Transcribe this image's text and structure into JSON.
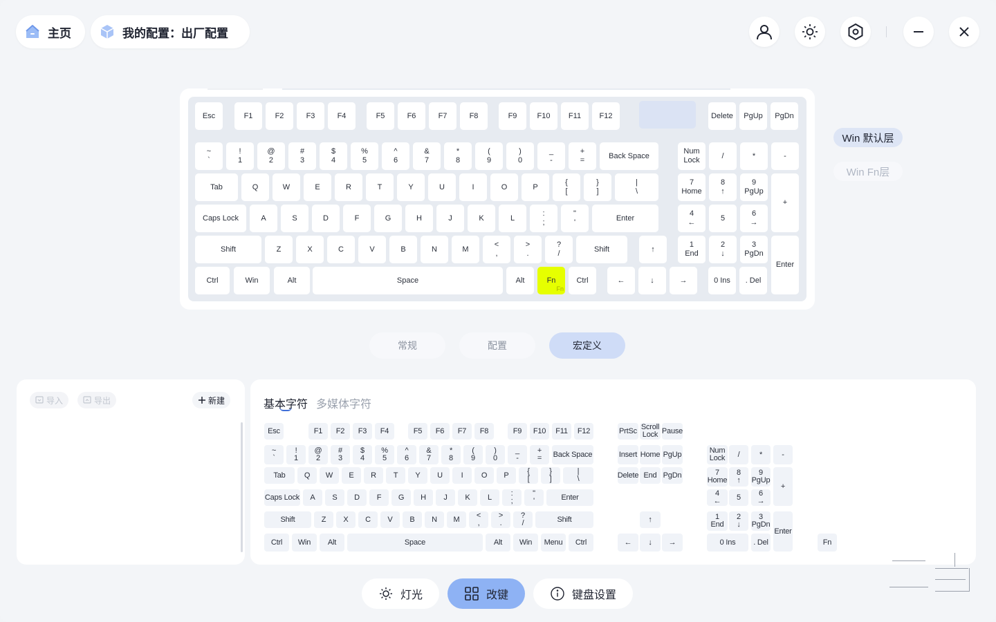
{
  "topbar": {
    "home_label": "主页",
    "config_label": "我的配置：出厂配置"
  },
  "layers": {
    "default": "Win 默认层",
    "fn": "Win Fn层"
  },
  "modes": [
    "常规",
    "配置",
    "宏定义"
  ],
  "left_panel": {
    "import_label": "导入",
    "export_label": "导出",
    "new_label": "新建"
  },
  "char_tabs": {
    "basic": "基本字符",
    "media": "多媒体字符"
  },
  "bottom_nav": {
    "light": "灯光",
    "remap": "改键",
    "settings": "键盘设置"
  },
  "colors": {
    "accent": "#8eb2f4",
    "selected_key": "#e6ff00",
    "active_mode": "#cfdcf7"
  },
  "keyboard": {
    "keys": [
      {
        "l": "Esc"
      },
      {
        "l": "F1"
      },
      {
        "l": "F2"
      },
      {
        "l": "F3"
      },
      {
        "l": "F4"
      },
      {
        "l": "F5"
      },
      {
        "l": "F6"
      },
      {
        "l": "F7"
      },
      {
        "l": "F8"
      },
      {
        "l": "F9"
      },
      {
        "l": "F10"
      },
      {
        "l": "F11"
      },
      {
        "l": "F12"
      },
      {
        "l": ""
      },
      {
        "l": "Delete"
      },
      {
        "l": "PgUp"
      },
      {
        "l": "PgDn"
      },
      {
        "l": "~\n`"
      },
      {
        "l": "!\n1"
      },
      {
        "l": "@\n2"
      },
      {
        "l": "#\n3"
      },
      {
        "l": "$\n4"
      },
      {
        "l": "%\n5"
      },
      {
        "l": "^\n6"
      },
      {
        "l": "&\n7"
      },
      {
        "l": "*\n8"
      },
      {
        "l": "(\n9"
      },
      {
        "l": ")\n0"
      },
      {
        "l": "_\n-"
      },
      {
        "l": "+\n="
      },
      {
        "l": "Back Space"
      },
      {
        "l": "Num\nLock"
      },
      {
        "l": "/"
      },
      {
        "l": "*"
      },
      {
        "l": "-"
      },
      {
        "l": "Tab"
      },
      {
        "l": "Q"
      },
      {
        "l": "W"
      },
      {
        "l": "E"
      },
      {
        "l": "R"
      },
      {
        "l": "T"
      },
      {
        "l": "Y"
      },
      {
        "l": "U"
      },
      {
        "l": "I"
      },
      {
        "l": "O"
      },
      {
        "l": "P"
      },
      {
        "l": "{\n["
      },
      {
        "l": "}\n]"
      },
      {
        "l": "|\n\\"
      },
      {
        "l": "7\nHome"
      },
      {
        "l": "8\n↑"
      },
      {
        "l": "9\nPgUp"
      },
      {
        "l": "+"
      },
      {
        "l": "Caps Lock"
      },
      {
        "l": "A"
      },
      {
        "l": "S"
      },
      {
        "l": "D"
      },
      {
        "l": "F"
      },
      {
        "l": "G"
      },
      {
        "l": "H"
      },
      {
        "l": "J"
      },
      {
        "l": "K"
      },
      {
        "l": "L"
      },
      {
        "l": ":\n;"
      },
      {
        "l": "\"\n'"
      },
      {
        "l": "Enter"
      },
      {
        "l": "4\n←"
      },
      {
        "l": "5"
      },
      {
        "l": "6\n→"
      },
      {
        "l": "Shift"
      },
      {
        "l": "Z"
      },
      {
        "l": "X"
      },
      {
        "l": "C"
      },
      {
        "l": "V"
      },
      {
        "l": "B"
      },
      {
        "l": "N"
      },
      {
        "l": "M"
      },
      {
        "l": "<\n,"
      },
      {
        "l": ">\n."
      },
      {
        "l": "?\n/"
      },
      {
        "l": "Shift"
      },
      {
        "l": "↑"
      },
      {
        "l": "1\nEnd"
      },
      {
        "l": "2\n↓"
      },
      {
        "l": "3\nPgDn"
      },
      {
        "l": "Enter"
      },
      {
        "l": "Ctrl"
      },
      {
        "l": "Win"
      },
      {
        "l": "Alt"
      },
      {
        "l": "Space"
      },
      {
        "l": "Alt"
      },
      {
        "l": "Fn",
        "selected": true,
        "sub": "Fn"
      },
      {
        "l": "Ctrl"
      },
      {
        "l": "←"
      },
      {
        "l": "↓"
      },
      {
        "l": "→"
      },
      {
        "l": "0 Ins"
      },
      {
        "l": ". Del"
      }
    ]
  },
  "charset": {
    "keys": [
      "Esc",
      "F1",
      "F2",
      "F3",
      "F4",
      "F5",
      "F6",
      "F7",
      "F8",
      "F9",
      "F10",
      "F11",
      "F12",
      "PrtSc",
      "Scroll\nLock",
      "Pause",
      "~\n`",
      "!\n1",
      "@\n2",
      "#\n3",
      "$\n4",
      "%\n5",
      "^\n6",
      "&\n7",
      "*\n8",
      "(\n9",
      ")\n0",
      "_\n-",
      "+\n=",
      "Back Space",
      "Insert",
      "Home",
      "PgUp",
      "Num\nLock",
      "/",
      "*",
      "-",
      "Tab",
      "Q",
      "W",
      "E",
      "R",
      "T",
      "Y",
      "U",
      "I",
      "O",
      "P",
      "{\n[",
      "}\n]",
      "|\n\\",
      "Delete",
      "End",
      "PgDn",
      "7\nHome",
      "8\n↑",
      "9\nPgUp",
      "+",
      "Caps Lock",
      "A",
      "S",
      "D",
      "F",
      "G",
      "H",
      "J",
      "K",
      "L",
      ":\n;",
      "\"\n'",
      "Enter",
      "4\n←",
      "5",
      "6\n→",
      "Shift",
      "Z",
      "X",
      "C",
      "V",
      "B",
      "N",
      "M",
      "<\n,",
      ">\n.",
      "?\n/",
      "Shift",
      "↑",
      "1\nEnd",
      "2\n↓",
      "3\nPgDn",
      "Enter",
      "Ctrl",
      "Win",
      "Alt",
      "Space",
      "Alt",
      "Win",
      "Menu",
      "Ctrl",
      "←",
      "↓",
      "→",
      "0 Ins",
      ". Del",
      "Fn"
    ]
  }
}
